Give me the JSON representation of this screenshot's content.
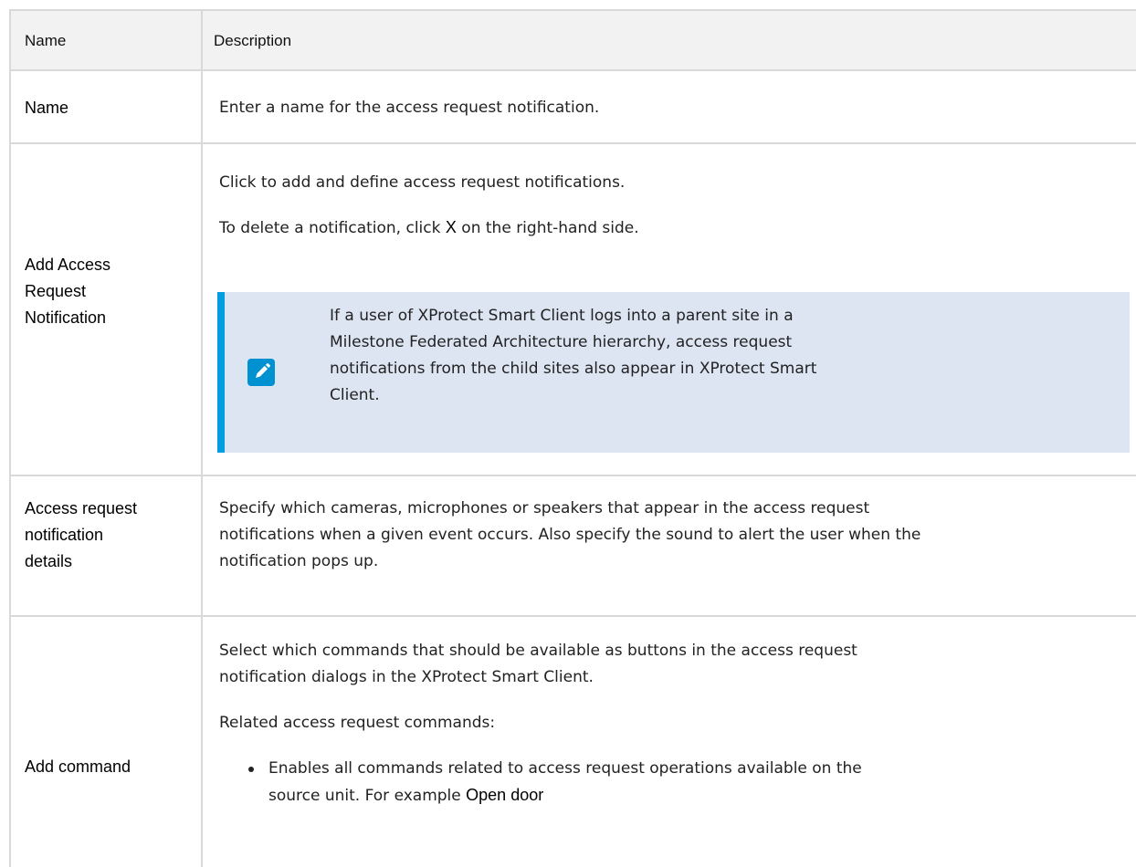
{
  "table": {
    "header": {
      "name": "Name",
      "description": "Description"
    },
    "rows": [
      {
        "name": "Name",
        "description": "Enter a name for the access request notification."
      },
      {
        "name": "Add Access Request Notification",
        "name_lines": [
          "Add Access",
          "Request",
          "Notification"
        ],
        "p1": "Click to add and define access request notifications.",
        "p2_before": "To delete a notification, click ",
        "p2_key": "X",
        "p2_after": " on the right-hand side.",
        "note_lines": [
          "If a user of XProtect Smart Client logs into a parent site in a",
          "Milestone Federated Architecture hierarchy, access request",
          "notifications from the child sites also appear in XProtect Smart",
          "Client."
        ]
      },
      {
        "name_lines": [
          "Access request",
          "notification",
          "details"
        ],
        "desc_lines": [
          "Specify which cameras, microphones or speakers that appear in the access request",
          "notifications when a given event occurs. Also specify the sound to alert the user when the",
          "notification pops up."
        ]
      },
      {
        "name": "Add command",
        "p1_lines": [
          "Select which commands that should be available as buttons in the access request",
          "notification dialogs in the XProtect Smart Client."
        ],
        "p2": "Related access request commands:",
        "bullet_lines": [
          "Enables all commands related to access request operations available on the",
          "source unit. For example "
        ],
        "bullet_bold": "Open door"
      }
    ]
  },
  "colors": {
    "header_bg": "#f2f2f2",
    "border": "#d9d9d9",
    "note_bg": "#dde5f3",
    "note_accent": "#009de0",
    "icon_bg": "#0091d1"
  },
  "icons": {
    "note": "pencil-edit-icon"
  }
}
